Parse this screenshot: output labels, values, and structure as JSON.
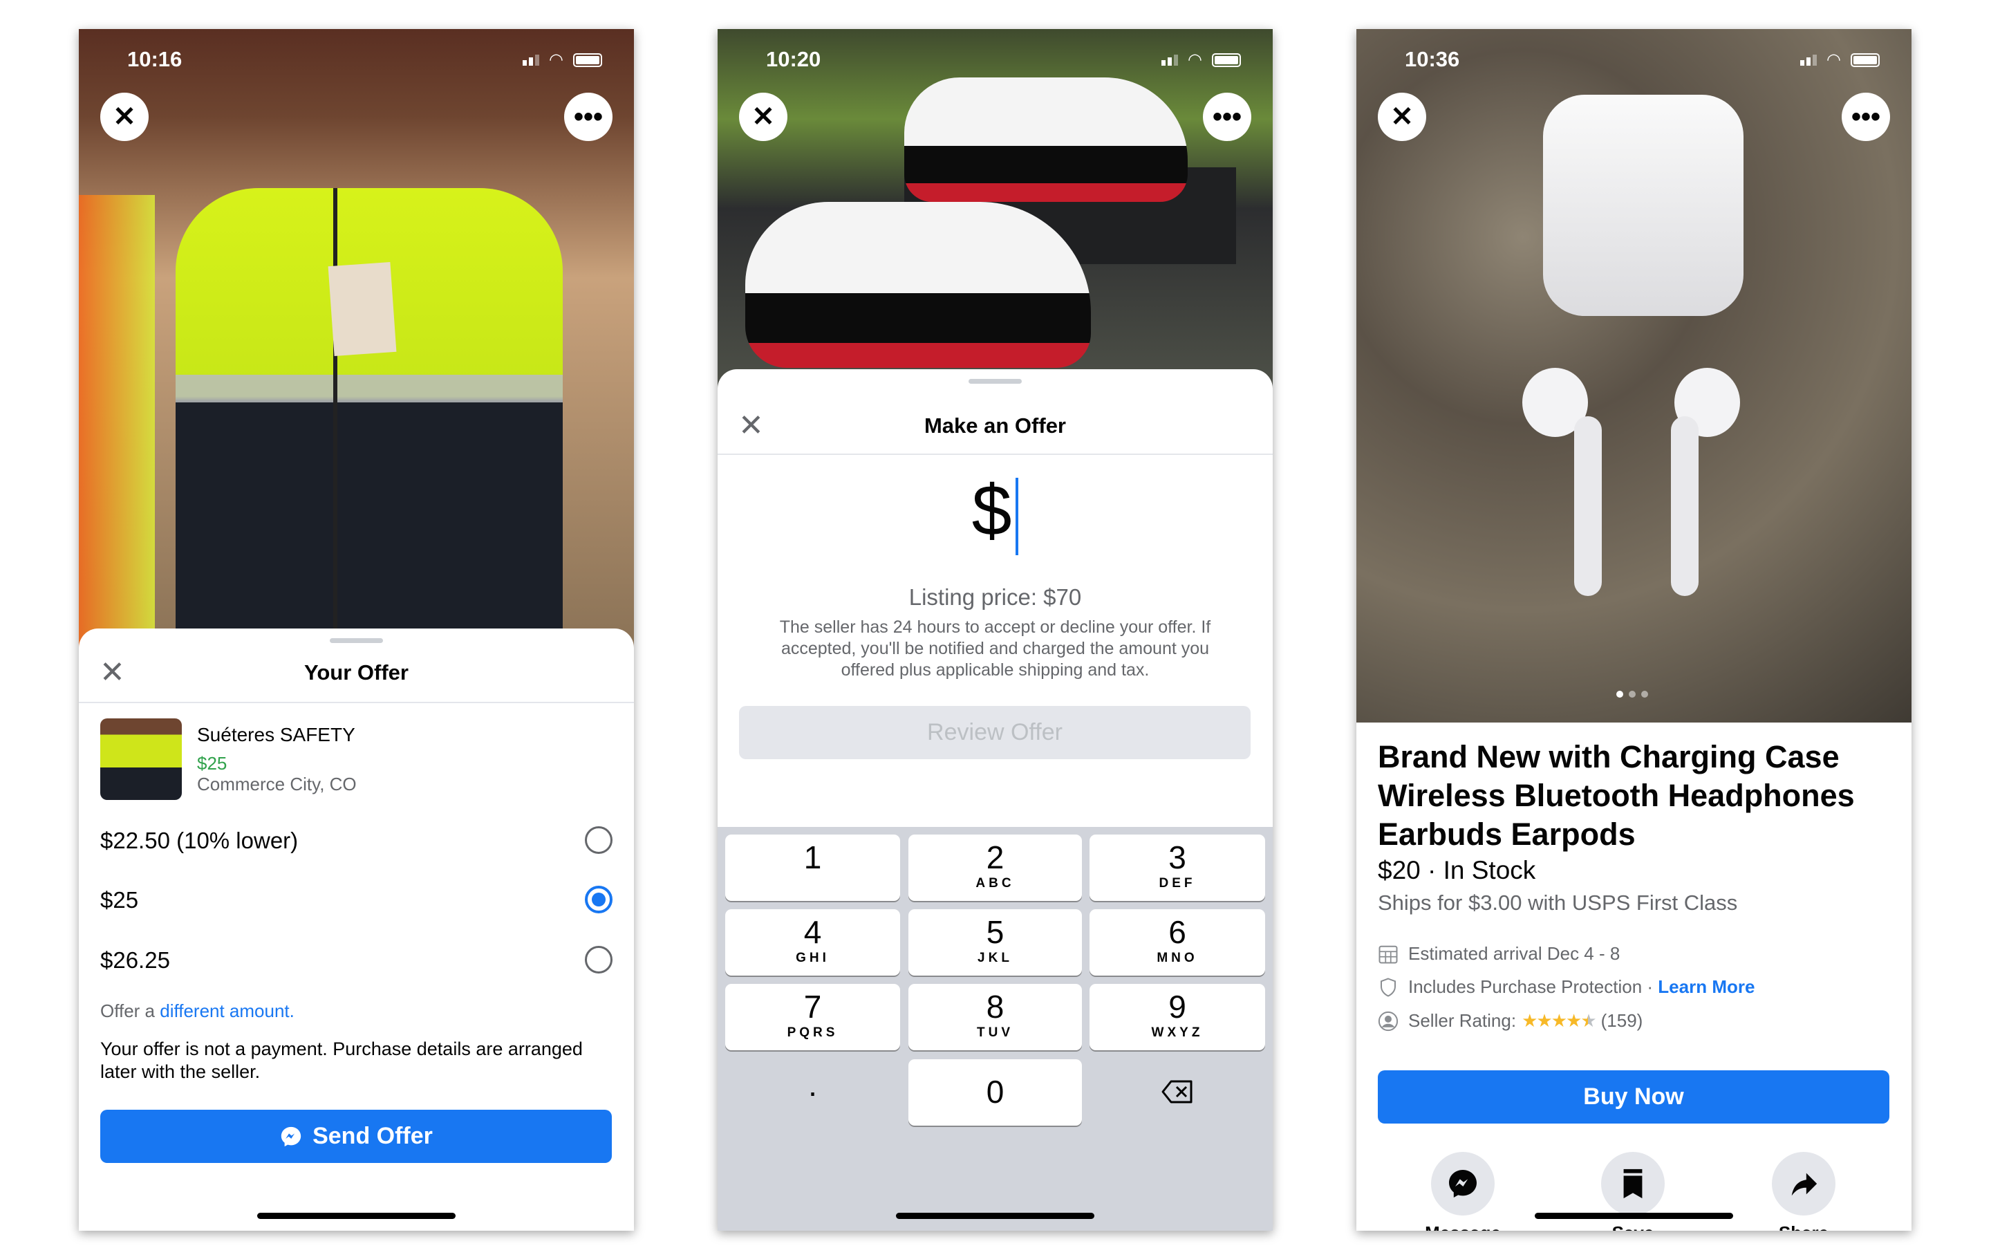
{
  "screens": [
    {
      "status_time": "10:16",
      "sheet_title": "Your Offer",
      "listing": {
        "name": "Suéteres SAFETY",
        "price": "$25",
        "location": "Commerce City, CO"
      },
      "options": [
        {
          "label": "$22.50 (10% lower)",
          "selected": false
        },
        {
          "label": "$25",
          "selected": true
        },
        {
          "label": "$26.25",
          "selected": false
        }
      ],
      "different_prefix": "Offer a ",
      "different_link": "different amount.",
      "disclaimer": "Your offer is not a payment. Purchase details are arranged later with the seller.",
      "send_button": "Send Offer"
    },
    {
      "status_time": "10:20",
      "sheet_title": "Make an Offer",
      "amount_value": "$",
      "listing_price": "Listing price: $70",
      "note": "The seller has 24 hours to accept or decline your offer. If accepted, you'll be notified and charged the amount you offered plus applicable shipping and tax.",
      "review_button": "Review Offer",
      "keys": [
        {
          "n": "1",
          "s": ""
        },
        {
          "n": "2",
          "s": "ABC"
        },
        {
          "n": "3",
          "s": "DEF"
        },
        {
          "n": "4",
          "s": "GHI"
        },
        {
          "n": "5",
          "s": "JKL"
        },
        {
          "n": "6",
          "s": "MNO"
        },
        {
          "n": "7",
          "s": "PQRS"
        },
        {
          "n": "8",
          "s": "TUV"
        },
        {
          "n": "9",
          "s": "WXYZ"
        }
      ],
      "key_dot": ".",
      "key_zero": "0"
    },
    {
      "status_time": "10:36",
      "title": "Brand New with Charging Case Wireless Bluetooth Headphones Earbuds Earpods",
      "price_stock": "$20 · In Stock",
      "shipping": "Ships for $3.00 with USPS First Class",
      "arrival": "Estimated arrival Dec 4 - 8",
      "protection": "Includes Purchase Protection · ",
      "learn_more": "Learn More",
      "rating_label": "Seller Rating:",
      "rating_stars": 4.5,
      "rating_count": "(159)",
      "photo_index": 1,
      "photo_count": 3,
      "buy_button": "Buy Now",
      "actions": [
        "Message",
        "Save",
        "Share"
      ]
    }
  ],
  "colors": {
    "accent": "#1877f2",
    "price_green": "#31a24c",
    "star": "#f7b928"
  }
}
